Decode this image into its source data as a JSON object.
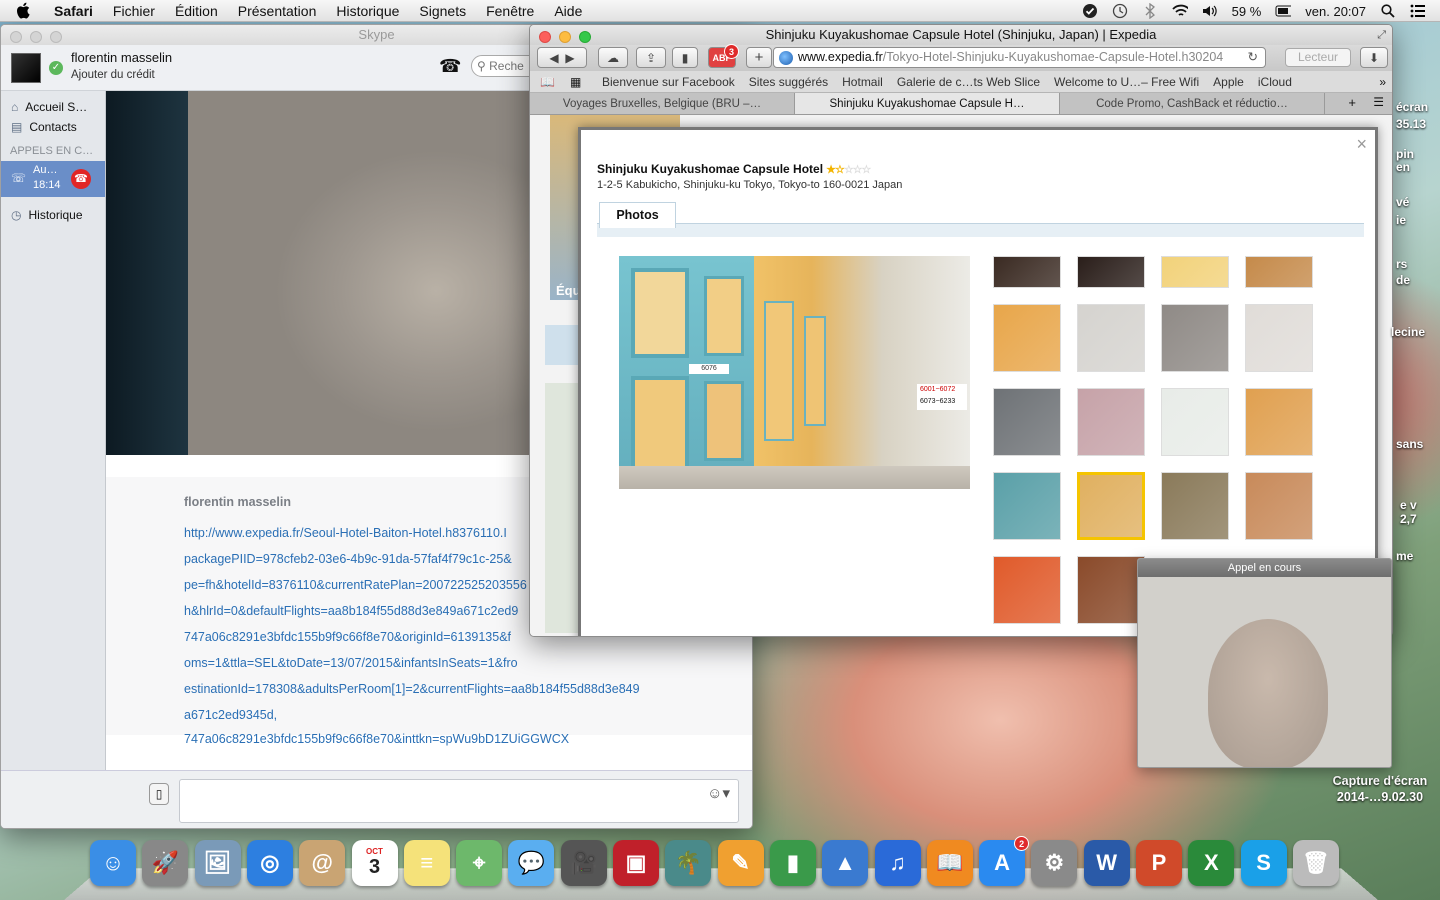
{
  "menubar": {
    "app": "Safari",
    "items": [
      "Fichier",
      "Édition",
      "Présentation",
      "Historique",
      "Signets",
      "Fenêtre",
      "Aide"
    ],
    "battery": "59 %",
    "clock": "ven. 20:07"
  },
  "skype": {
    "title": "Skype",
    "profile_name": "florentin masselin",
    "credit": "Ajouter du crédit",
    "search_placeholder": "Reche",
    "nav": {
      "home": "Accueil S…",
      "contacts": "Contacts",
      "calls_header": "APPELS EN C…",
      "call_name": "Au…",
      "call_time": "18:14",
      "history": "Historique"
    },
    "chat": {
      "sender": "florentin masselin",
      "lines": [
        "http://www.expedia.fr/Seoul-Hotel-Baiton-Hotel.h8376110.I",
        "packagePIID=978cfeb2-03e6-4b9c-91da-57faf4f79c1c-25&",
        "pe=fh&hotelId=8376110&currentRatePlan=200722525203556",
        "h&hlrId=0&defaultFlights=aa8b184f55d88d3e849a671c2ed9",
        "747a06c8291e3bfdc155b9f9c66f8e70&originId=6139135&f",
        "oms=1&ttla=SEL&toDate=13/07/2015&infantsInSeats=1&fro",
        "estinationId=178308&adultsPerRoom[1]=2&currentFlights=aa8b184f55d88d3e849",
        "a671c2ed9345d,",
        "747a06c8291e3bfdc155b9f9c66f8e70&inttkn=spWu9bD1ZUiGGWCX"
      ]
    }
  },
  "safari": {
    "title": "Shinjuku Kuyakushomae Capsule Hotel (Shinjuku, Japan) | Expedia",
    "adblock_count": "3",
    "url_host": "www.expedia.fr",
    "url_path": "/Tokyo-Hotel-Shinjuku-Kuyakushomae-Capsule-Hotel.h30204",
    "reader": "Lecteur",
    "bookmarks": [
      "Bienvenue sur Facebook",
      "Sites suggérés",
      "Hotmail",
      "Galerie de c…ts Web Slice",
      "Welcome to U…– Free Wifi",
      "Apple",
      "iCloud"
    ],
    "tabs": [
      "Voyages Bruxelles, Belgique (BRU –…",
      "Shinjuku Kuyakushomae Capsule H…",
      "Code Promo, CashBack et réductio…"
    ],
    "page_partial": "Équ"
  },
  "hotel": {
    "name": "Shinjuku Kuyakushomae Capsule Hotel",
    "rating": 1.5,
    "address": "1-2-5 Kabukicho, Shinjuku-ku Tokyo, Tokyo-to 160-0021 Japan",
    "tab": "Photos",
    "sign_lines": [
      "6001~6072",
      "6073~6233"
    ],
    "capsule_number": "6076",
    "thumbnails": [
      "lobby",
      "bar",
      "hallway",
      "capsule-corridor",
      "control-panel",
      "urinal",
      "sinks",
      "toilet",
      "washroom",
      "amenities",
      "bath",
      "changing-room",
      "capsule-row",
      "capsule-bunks",
      "locker-room",
      "vanity",
      "vending-machine",
      "drinks-machine"
    ],
    "selected_thumbnail": 13
  },
  "pip": {
    "label": "Appel en cours"
  },
  "desktop": {
    "screenshot_label_1": "Capture d'écran",
    "screenshot_label_2": "2014-…9.02.30",
    "right_texts": [
      "écran",
      "35.13",
      "pin",
      "en",
      "vé",
      "ie",
      "rs",
      "de",
      "lecine",
      "sans",
      "e v",
      "2,7",
      "me"
    ]
  },
  "dock": {
    "apps": [
      "finder",
      "launchpad",
      "preview",
      "safari",
      "contacts",
      "calendar",
      "stickies",
      "maps",
      "messages",
      "facetime",
      "photo-booth",
      "iphoto",
      "pages",
      "numbers",
      "keynote",
      "itunes",
      "ibooks",
      "app-store",
      "system-preferences",
      "word",
      "powerpoint",
      "excel",
      "skype",
      "trash"
    ],
    "calendar_day": "3",
    "calendar_month": "OCT",
    "appstore_badge": "2"
  }
}
